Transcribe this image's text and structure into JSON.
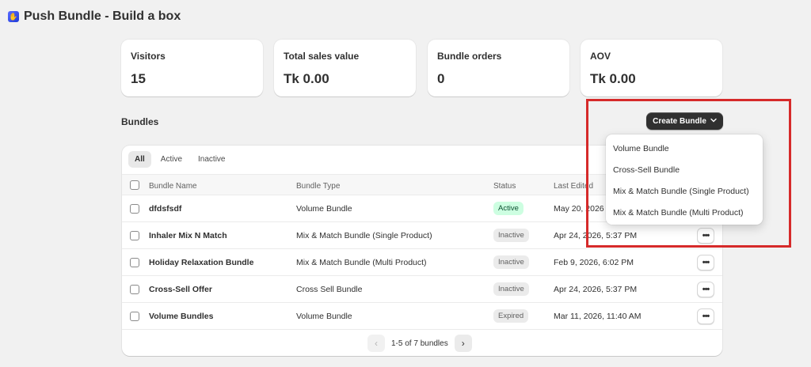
{
  "app": {
    "title": "Push Bundle - Build a box"
  },
  "stats": [
    {
      "label": "Visitors",
      "value": "15"
    },
    {
      "label": "Total sales value",
      "value": "Tk 0.00"
    },
    {
      "label": "Bundle orders",
      "value": "0"
    },
    {
      "label": "AOV",
      "value": "Tk 0.00"
    }
  ],
  "bundles": {
    "title": "Bundles",
    "create_button": "Create Bundle",
    "tabs": [
      "All",
      "Active",
      "Inactive"
    ],
    "columns": [
      "Bundle Name",
      "Bundle Type",
      "Status",
      "Last Edited"
    ],
    "rows": [
      {
        "name": "dfdsfsdf",
        "type": "Volume Bundle",
        "status": "Active",
        "last_edited": "May 20, 2026"
      },
      {
        "name": "Inhaler Mix N Match",
        "type": "Mix & Match Bundle (Single Product)",
        "status": "Inactive",
        "last_edited": "Apr 24, 2026, 5:37 PM"
      },
      {
        "name": "Holiday Relaxation Bundle",
        "type": "Mix & Match Bundle (Multi Product)",
        "status": "Inactive",
        "last_edited": "Feb 9, 2026, 6:02 PM"
      },
      {
        "name": "Cross-Sell Offer",
        "type": "Cross Sell Bundle",
        "status": "Inactive",
        "last_edited": "Apr 24, 2026, 5:37 PM"
      },
      {
        "name": "Volume Bundles",
        "type": "Volume Bundle",
        "status": "Expired",
        "last_edited": "Mar 11, 2026, 11:40 AM"
      }
    ],
    "pagination": "1-5 of 7 bundles"
  },
  "dropdown": {
    "items": [
      "Volume Bundle",
      "Cross-Sell Bundle",
      "Mix & Match Bundle (Single Product)",
      "Mix & Match Bundle (Multi Product)"
    ]
  },
  "colors": {
    "primary_button": "#303030",
    "active_badge_bg": "#cdfee1",
    "highlight": "#d62a2a"
  },
  "icons": {
    "app_logo": "app-logo-icon",
    "chevron": "chevron-down-icon",
    "more": "more-horizontal-icon",
    "prev": "chevron-left-icon",
    "next": "chevron-right-icon"
  }
}
